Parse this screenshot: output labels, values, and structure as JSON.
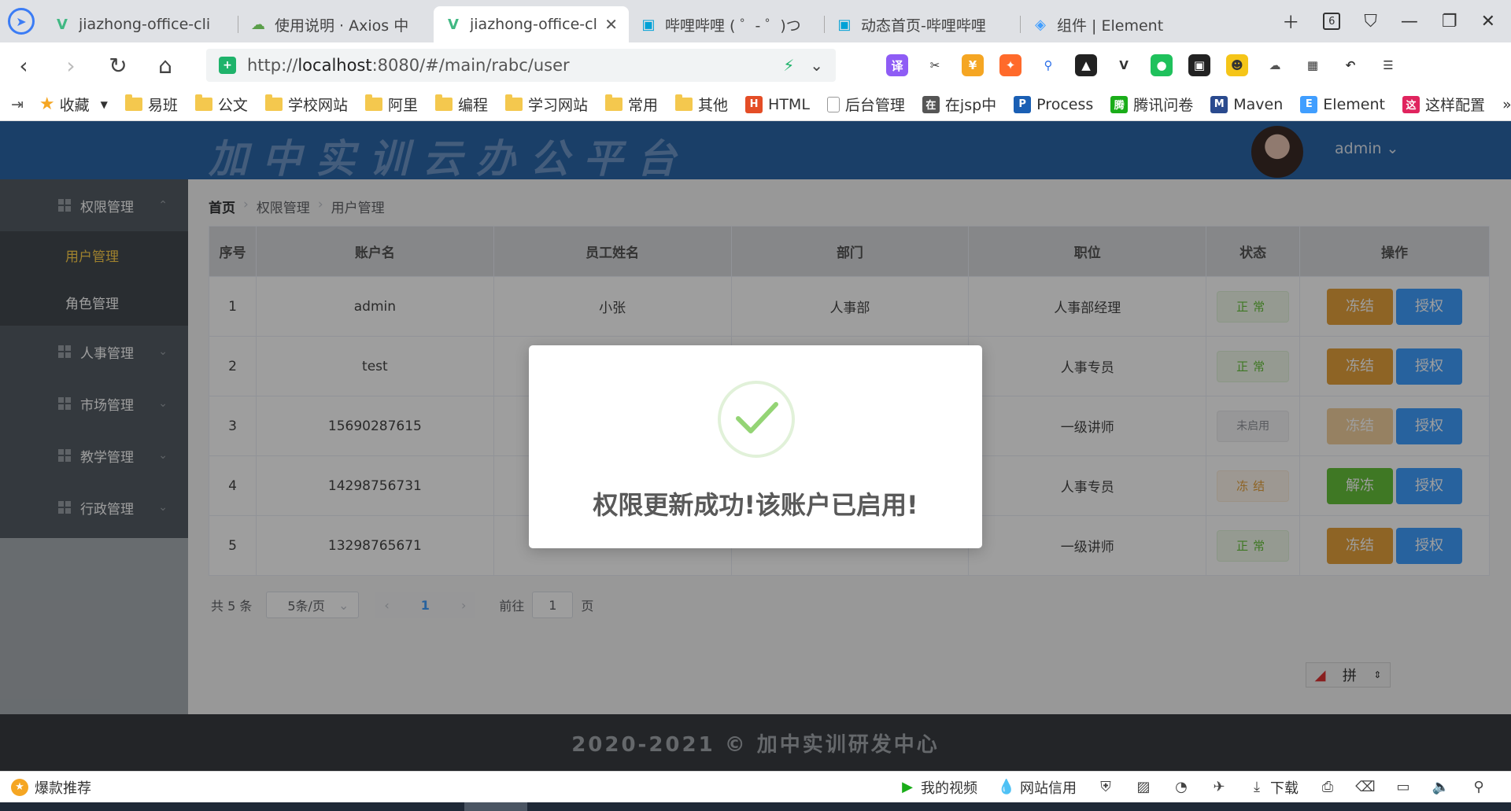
{
  "browser": {
    "tabs": [
      {
        "title": "jiazhong-office-cli",
        "icon": "vue-icon",
        "color": "#41b883",
        "active": false
      },
      {
        "title": "使用说明 · Axios 中",
        "icon": "axios-icon",
        "color": "#5a9e4a",
        "active": false
      },
      {
        "title": "jiazhong-office-cli",
        "icon": "vue-icon",
        "color": "#41b883",
        "active": true
      },
      {
        "title": "哔哩哔哩 ( ゜- ゜)つ",
        "icon": "bilibili-icon",
        "color": "#00a1d6",
        "active": false
      },
      {
        "title": "动态首页-哔哩哔哩",
        "icon": "bilibili-icon",
        "color": "#00a1d6",
        "active": false
      },
      {
        "title": "组件 | Element",
        "icon": "element-icon",
        "color": "#409eff",
        "active": false
      }
    ],
    "tab_count": "6",
    "url_prefix": "http://",
    "url_host": "localhost",
    "url_rest": ":8080/#/main/rabc/user",
    "bookmarks": [
      {
        "label": "收藏",
        "type": "star"
      },
      {
        "label": "易班",
        "type": "folder"
      },
      {
        "label": "公文",
        "type": "folder"
      },
      {
        "label": "学校网站",
        "type": "folder"
      },
      {
        "label": "阿里",
        "type": "folder"
      },
      {
        "label": "编程",
        "type": "folder"
      },
      {
        "label": "学习网站",
        "type": "folder"
      },
      {
        "label": "常用",
        "type": "folder"
      },
      {
        "label": "其他",
        "type": "folder"
      },
      {
        "label": "HTML",
        "type": "site",
        "color": "#e44d26"
      },
      {
        "label": "后台管理",
        "type": "page"
      },
      {
        "label": "在jsp中",
        "type": "site",
        "color": "#555"
      },
      {
        "label": "Process",
        "type": "site",
        "color": "#1a5fb4"
      },
      {
        "label": "腾讯问卷",
        "type": "site",
        "color": "#1aad19"
      },
      {
        "label": "Maven",
        "type": "site",
        "color": "#2a4a8e"
      },
      {
        "label": "Element",
        "type": "site",
        "color": "#409eff"
      },
      {
        "label": "这样配置",
        "type": "site",
        "color": "#e0245e"
      }
    ],
    "more": "»"
  },
  "app": {
    "title": "加中实训云办公平台",
    "user": "admin",
    "footer": "2020-2021 © 加中实训研发中心"
  },
  "sidebar": {
    "groups": [
      {
        "label": "权限管理",
        "arrow": "⌃",
        "children": [
          {
            "label": "用户管理",
            "active": true
          },
          {
            "label": "角色管理",
            "active": false
          }
        ]
      },
      {
        "label": "人事管理",
        "arrow": "⌄"
      },
      {
        "label": "市场管理",
        "arrow": "⌄"
      },
      {
        "label": "教学管理",
        "arrow": "⌄"
      },
      {
        "label": "行政管理",
        "arrow": "⌄"
      }
    ]
  },
  "breadcrumb": [
    "首页",
    "权限管理",
    "用户管理"
  ],
  "table": {
    "headers": [
      "序号",
      "账户名",
      "员工姓名",
      "部门",
      "职位",
      "状态",
      "操作"
    ],
    "rows": [
      {
        "no": "1",
        "account": "admin",
        "name": "小张",
        "dept": "人事部",
        "position": "人事部经理",
        "status": "正常",
        "status_type": "ok",
        "action": "冻结",
        "action_type": "freeze"
      },
      {
        "no": "2",
        "account": "test",
        "name": "",
        "dept": "",
        "position": "人事专员",
        "status": "正常",
        "status_type": "ok",
        "action": "冻结",
        "action_type": "freeze"
      },
      {
        "no": "3",
        "account": "15690287615",
        "name": "",
        "dept": "",
        "position": "一级讲师",
        "status": "未启用",
        "status_type": "off",
        "action": "冻结",
        "action_type": "freeze dim"
      },
      {
        "no": "4",
        "account": "14298756731",
        "name": "",
        "dept": "",
        "position": "人事专员",
        "status": "冻结",
        "status_type": "frozen",
        "action": "解冻",
        "action_type": "thaw"
      },
      {
        "no": "5",
        "account": "13298765671",
        "name": "",
        "dept": "",
        "position": "一级讲师",
        "status": "正常",
        "status_type": "ok",
        "action": "冻结",
        "action_type": "freeze"
      }
    ],
    "grant_label": "授权"
  },
  "pager": {
    "total": "共 5 条",
    "page_size": "5条/页",
    "current_page": "1",
    "goto_label": "前往",
    "goto_value": "1",
    "page_unit": "页"
  },
  "ime": {
    "label": "拼"
  },
  "dialog": {
    "message": "权限更新成功!该账户已启用!",
    "icon": "success-check-icon",
    "check_color": "#67c23a"
  },
  "statusbar": {
    "left": "爆款推荐",
    "video": "我的视频",
    "credit": "网站信用",
    "download": "下载"
  }
}
